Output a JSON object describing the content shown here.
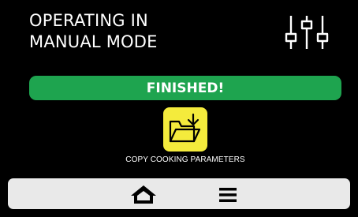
{
  "header": {
    "title_line1": "OPERATING IN",
    "title_line2": "MANUAL MODE",
    "settings_icon": "sliders-icon"
  },
  "status": {
    "text": "FINISHED!",
    "color": "#1ea44f"
  },
  "copy_action": {
    "label": "COPY COOKING PARAMETERS",
    "icon": "folder-download-icon",
    "color": "#f4eb3c"
  },
  "bottom_nav": {
    "background": "#e9e9e9",
    "home_icon": "home-icon",
    "menu_icon": "menu-icon"
  }
}
